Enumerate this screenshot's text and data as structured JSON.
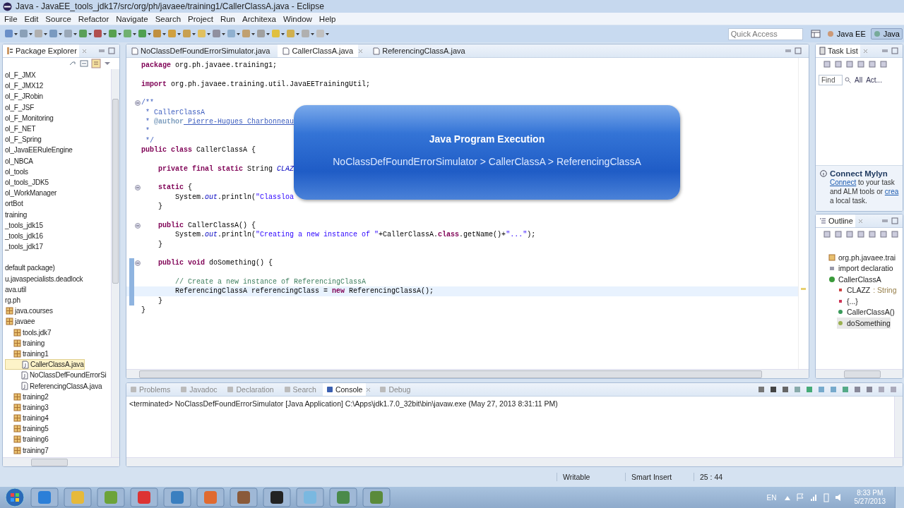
{
  "window": {
    "title": "Java - JavaEE_tools_jdk17/src/org/ph/javaee/training1/CallerClassA.java - Eclipse"
  },
  "menu": [
    "File",
    "Edit",
    "Source",
    "Refactor",
    "Navigate",
    "Search",
    "Project",
    "Run",
    "Architexa",
    "Window",
    "Help"
  ],
  "quick_access": {
    "placeholder": "Quick Access"
  },
  "perspectives": [
    {
      "label": "Java EE",
      "selected": false
    },
    {
      "label": "Java",
      "selected": true
    }
  ],
  "package_explorer": {
    "title": "Package Explorer",
    "projects": [
      {
        "label": "ol_F_JMX",
        "kind": "project",
        "selected": false
      },
      {
        "label": "ol_F_JMX12",
        "kind": "project",
        "selected": false
      },
      {
        "label": "ol_F_JRobin",
        "kind": "project",
        "selected": false
      },
      {
        "label": "ol_F_JSF",
        "kind": "project",
        "selected": false
      },
      {
        "label": "ol_F_Monitoring",
        "kind": "project",
        "selected": false
      },
      {
        "label": "ol_F_NET",
        "kind": "project",
        "selected": false
      },
      {
        "label": "ol_F_Spring",
        "kind": "project",
        "selected": false
      },
      {
        "label": "ol_JavaEERuleEngine",
        "kind": "project",
        "selected": false
      },
      {
        "label": "ol_NBCA",
        "kind": "project",
        "selected": false
      },
      {
        "label": "ol_tools",
        "kind": "project",
        "selected": false
      },
      {
        "label": "ol_tools_JDK5",
        "kind": "project",
        "selected": false
      },
      {
        "label": "ol_WorkManager",
        "kind": "project",
        "selected": false
      },
      {
        "label": "ortBot",
        "kind": "project",
        "selected": false
      },
      {
        "label": "training",
        "kind": "project",
        "selected": false
      },
      {
        "label": "_tools_jdk15",
        "kind": "project",
        "selected": false
      },
      {
        "label": "_tools_jdk16",
        "kind": "project",
        "selected": false
      },
      {
        "label": "_tools_jdk17",
        "kind": "project",
        "selected": false
      }
    ],
    "packages": [
      {
        "label": "default package)",
        "kind": "project",
        "selected": false
      },
      {
        "label": "u.javaspecialists.deadlock",
        "kind": "project",
        "selected": false
      },
      {
        "label": "ava.util",
        "kind": "project",
        "selected": false
      },
      {
        "label": "rg.ph",
        "kind": "project",
        "selected": false
      },
      {
        "label": "java.courses",
        "kind": "package",
        "selected": false
      },
      {
        "label": "javaee",
        "kind": "package",
        "selected": false,
        "children": [
          {
            "label": "tools.jdk7",
            "kind": "package",
            "selected": false
          },
          {
            "label": "training",
            "kind": "package",
            "selected": false
          },
          {
            "label": "training1",
            "kind": "package",
            "selected": false,
            "children": [
              {
                "label": "CallerClassA.java",
                "kind": "file",
                "selected": true
              },
              {
                "label": "NoClassDefFoundErrorSi",
                "kind": "file",
                "selected": false
              },
              {
                "label": "ReferencingClassA.java",
                "kind": "file",
                "selected": false
              }
            ]
          },
          {
            "label": "training2",
            "kind": "package",
            "selected": false
          },
          {
            "label": "training3",
            "kind": "package",
            "selected": false
          },
          {
            "label": "training4",
            "kind": "package",
            "selected": false
          },
          {
            "label": "training5",
            "kind": "package",
            "selected": false
          },
          {
            "label": "training6",
            "kind": "package",
            "selected": false
          },
          {
            "label": "training7",
            "kind": "package",
            "selected": false
          }
        ]
      }
    ]
  },
  "editor_tabs": [
    {
      "label": "NoClassDefFoundErrorSimulator.java",
      "selected": false
    },
    {
      "label": "CallerClassA.java",
      "selected": true
    },
    {
      "label": "ReferencingClassA.java",
      "selected": false
    }
  ],
  "code": [
    {
      "kind": "code",
      "foldable": false,
      "changed": false,
      "current": false,
      "tokens": [
        {
          "t": "package",
          "kind": "kw"
        },
        {
          "t": " org.ph.javaee.training1;",
          "kind": "plain"
        }
      ]
    },
    {
      "kind": "blank"
    },
    {
      "kind": "code",
      "foldable": false,
      "changed": false,
      "current": false,
      "tokens": [
        {
          "t": "import",
          "kind": "kw"
        },
        {
          "t": " org.ph.javaee.training.util.JavaEETrainingUtil;",
          "kind": "plain"
        }
      ]
    },
    {
      "kind": "blank"
    },
    {
      "kind": "code",
      "foldable": true,
      "changed": false,
      "current": false,
      "tokens": [
        {
          "t": "/**",
          "kind": "doc"
        }
      ]
    },
    {
      "kind": "code",
      "foldable": false,
      "changed": false,
      "current": false,
      "tokens": [
        {
          "t": " * CallerClassA",
          "kind": "doc"
        }
      ]
    },
    {
      "kind": "code",
      "foldable": false,
      "changed": false,
      "current": false,
      "tokens": [
        {
          "t": " * ",
          "kind": "doc"
        },
        {
          "t": "@author",
          "kind": "tag"
        },
        {
          "t": " Pierre-Hugues Charbonneau",
          "kind": "doclink"
        }
      ]
    },
    {
      "kind": "code",
      "foldable": false,
      "changed": false,
      "current": false,
      "tokens": [
        {
          "t": " *",
          "kind": "doc"
        }
      ]
    },
    {
      "kind": "code",
      "foldable": false,
      "changed": false,
      "current": false,
      "tokens": [
        {
          "t": " */",
          "kind": "doc"
        }
      ]
    },
    {
      "kind": "code",
      "foldable": false,
      "changed": false,
      "current": false,
      "tokens": [
        {
          "t": "public class",
          "kind": "kw"
        },
        {
          "t": " CallerClassA {",
          "kind": "plain"
        }
      ]
    },
    {
      "kind": "blank"
    },
    {
      "kind": "code",
      "foldable": false,
      "changed": false,
      "current": false,
      "tokens": [
        {
          "t": "    private final static",
          "kind": "kw"
        },
        {
          "t": " String ",
          "kind": "plain"
        },
        {
          "t": "CLAZ",
          "kind": "field"
        }
      ]
    },
    {
      "kind": "blank"
    },
    {
      "kind": "code",
      "foldable": true,
      "changed": false,
      "current": false,
      "tokens": [
        {
          "t": "    static",
          "kind": "kw"
        },
        {
          "t": " {",
          "kind": "plain"
        }
      ]
    },
    {
      "kind": "code",
      "foldable": false,
      "changed": false,
      "current": false,
      "tokens": [
        {
          "t": "        System.",
          "kind": "plain"
        },
        {
          "t": "out",
          "kind": "field"
        },
        {
          "t": ".println(",
          "kind": "plain"
        },
        {
          "t": "\"Classloa",
          "kind": "str"
        }
      ]
    },
    {
      "kind": "code",
      "foldable": false,
      "changed": false,
      "current": false,
      "tokens": [
        {
          "t": "    }",
          "kind": "plain"
        }
      ]
    },
    {
      "kind": "blank"
    },
    {
      "kind": "code",
      "foldable": true,
      "changed": false,
      "current": false,
      "tokens": [
        {
          "t": "    public",
          "kind": "kw"
        },
        {
          "t": " CallerClassA() {",
          "kind": "plain"
        }
      ]
    },
    {
      "kind": "code",
      "foldable": false,
      "changed": false,
      "current": false,
      "tokens": [
        {
          "t": "        System.",
          "kind": "plain"
        },
        {
          "t": "out",
          "kind": "field"
        },
        {
          "t": ".println(",
          "kind": "plain"
        },
        {
          "t": "\"Creating a new instance of \"",
          "kind": "str"
        },
        {
          "t": "+CallerClassA.",
          "kind": "plain"
        },
        {
          "t": "class",
          "kind": "kw"
        },
        {
          "t": ".getName()+",
          "kind": "plain"
        },
        {
          "t": "\"...\"",
          "kind": "str"
        },
        {
          "t": ");",
          "kind": "plain"
        }
      ]
    },
    {
      "kind": "code",
      "foldable": false,
      "changed": false,
      "current": false,
      "tokens": [
        {
          "t": "    }",
          "kind": "plain"
        }
      ]
    },
    {
      "kind": "blank"
    },
    {
      "kind": "code",
      "foldable": true,
      "changed": true,
      "current": false,
      "tokens": [
        {
          "t": "    public void",
          "kind": "kw"
        },
        {
          "t": " doSomething() {",
          "kind": "plain"
        }
      ]
    },
    {
      "kind": "blank"
    },
    {
      "kind": "code",
      "foldable": false,
      "changed": true,
      "current": false,
      "tokens": [
        {
          "t": "        // Create a new instance of ReferencingClassA",
          "kind": "comment"
        }
      ]
    },
    {
      "kind": "code",
      "foldable": false,
      "changed": true,
      "current": true,
      "tokens": [
        {
          "t": "        ReferencingClassA referencingClass = ",
          "kind": "plain"
        },
        {
          "t": "new",
          "kind": "kw"
        },
        {
          "t": " ReferencingClassA();",
          "kind": "plain"
        }
      ]
    },
    {
      "kind": "code",
      "foldable": false,
      "changed": true,
      "current": false,
      "tokens": [
        {
          "t": "    }",
          "kind": "plain"
        }
      ]
    },
    {
      "kind": "code",
      "foldable": false,
      "changed": false,
      "current": false,
      "tokens": [
        {
          "t": "}",
          "kind": "plain"
        }
      ]
    }
  ],
  "overlay": {
    "title": "Java Program Execution",
    "subtitle": "NoClassDefFoundErrorSimulator > CallerClassA > ReferencingClassA"
  },
  "task_list": {
    "title": "Task List",
    "find": {
      "placeholder": "Find"
    },
    "filters": [
      "All",
      "Act..."
    ],
    "mylyn": {
      "title": "Connect Mylyn",
      "lines": [
        [
          {
            "t": "Connect",
            "kind": "link"
          },
          {
            "t": " to your task",
            "kind": "text"
          }
        ],
        [
          {
            "t": "and ALM tools or ",
            "kind": "text"
          },
          {
            "t": "crea",
            "kind": "link"
          }
        ],
        [
          {
            "t": "a local task.",
            "kind": "text"
          }
        ]
      ]
    }
  },
  "outline": {
    "title": "Outline",
    "items": [
      {
        "label": "org.ph.javaee.trai",
        "kind": "package",
        "selected": false
      },
      {
        "label": "import declaratio",
        "kind": "imports",
        "selected": false
      },
      {
        "label": "CallerClassA",
        "kind": "class",
        "selected": false,
        "children": [
          {
            "label": "CLAZZ",
            "detail": " : String",
            "kind": "field",
            "selected": false
          },
          {
            "label": "{...}",
            "kind": "static",
            "selected": false
          },
          {
            "label": "CallerClassA()",
            "kind": "constructor",
            "selected": false
          },
          {
            "label": "doSomething",
            "kind": "method",
            "selected": true
          }
        ]
      }
    ]
  },
  "console": {
    "tabs": [
      {
        "label": "Problems",
        "selected": false
      },
      {
        "label": "Javadoc",
        "selected": false
      },
      {
        "label": "Declaration",
        "selected": false
      },
      {
        "label": "Search",
        "selected": false
      },
      {
        "label": "Console",
        "selected": true
      },
      {
        "label": "Debug",
        "selected": false
      }
    ],
    "text": "<terminated> NoClassDefFoundErrorSimulator [Java Application] C:\\Apps\\jdk1.7.0_32bit\\bin\\javaw.exe (May 27, 2013 8:31:11 PM)"
  },
  "status_bar": [
    "Writable",
    "Smart Insert",
    "25 : 44"
  ],
  "taskbar": {
    "language": "EN",
    "time": "8:33 PM",
    "date": "5/27/2013"
  }
}
